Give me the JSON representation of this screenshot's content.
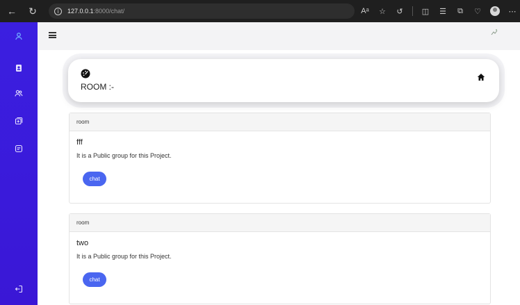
{
  "browser": {
    "url_host": "127.0.0.1",
    "url_path": ":8000/chat/",
    "read_aloud": "Aᵃ"
  },
  "sidebar": {
    "items": [
      "profile",
      "contacts",
      "groups",
      "add",
      "messages",
      "logout"
    ]
  },
  "header": {
    "room_title": "ROOM :-"
  },
  "rooms": [
    {
      "label": "room",
      "name": "fff",
      "description": "It is a Public group for this Project.",
      "button": "chat"
    },
    {
      "label": "room",
      "name": "two",
      "description": "It is a Public group for this Project.",
      "button": "chat"
    }
  ],
  "colors": {
    "sidebar": "#3b1fe0",
    "accent_button": "#4a66f0",
    "chrome": "#1f1f1f"
  }
}
